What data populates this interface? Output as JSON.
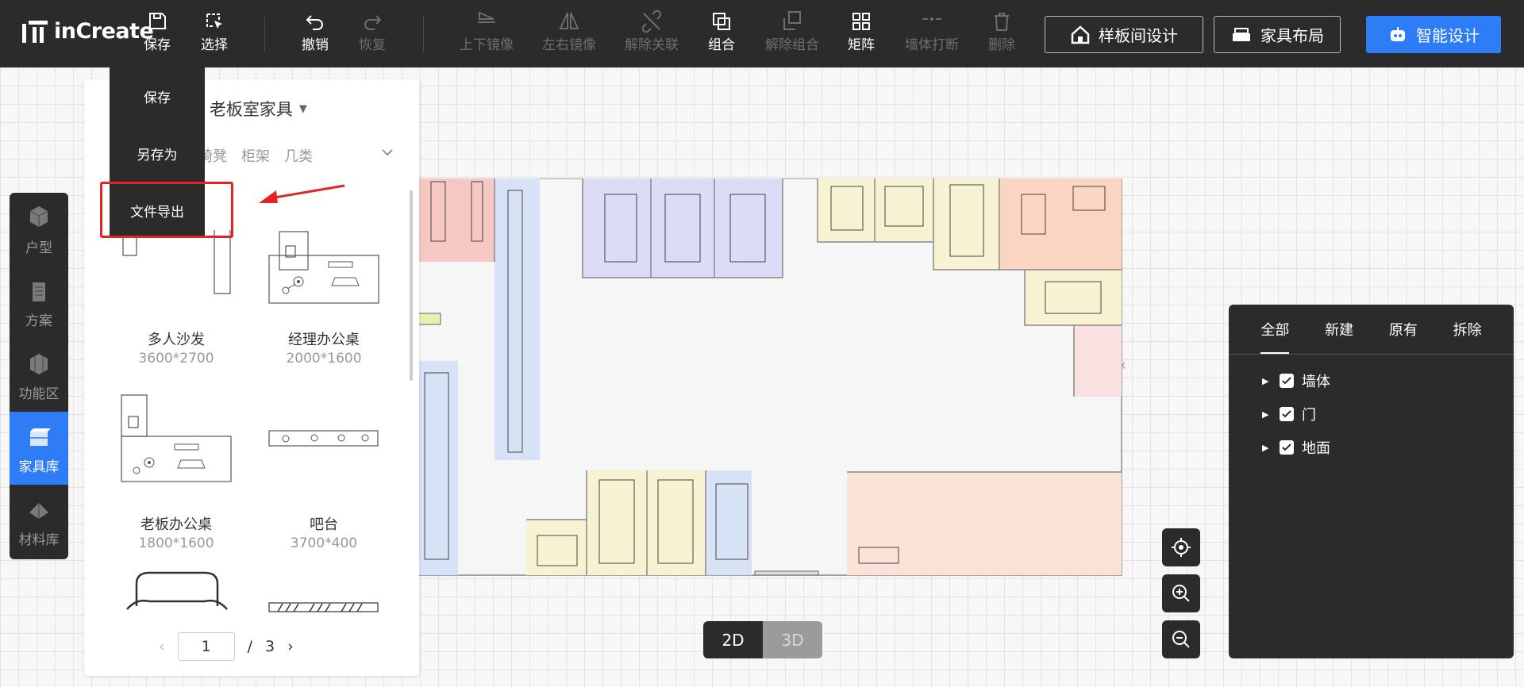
{
  "app": {
    "name": "inCreate"
  },
  "toolbar": {
    "save": "保存",
    "select": "选择",
    "undo": "撤销",
    "redo": "恢复",
    "mirror_v": "上下镜像",
    "mirror_h": "左右镜像",
    "unlink": "解除关联",
    "group": "组合",
    "ungroup": "解除组合",
    "array": "矩阵",
    "wall_break": "墙体打断",
    "delete": "删除"
  },
  "actions": {
    "room_design": "样板间设计",
    "furniture_layout": "家具布局",
    "smart_design": "智能设计"
  },
  "save_menu": {
    "items": [
      "保存",
      "另存为",
      "文件导出"
    ],
    "highlighted": "文件导出"
  },
  "left_nav": {
    "items": [
      "户型",
      "方案",
      "功能区",
      "家具库",
      "材料库"
    ],
    "active": "家具库"
  },
  "library": {
    "category": "老板室家具",
    "filters": [
      "椅凳",
      "柜架",
      "几类"
    ],
    "items": [
      {
        "name": "多人沙发",
        "size": "3600*2700"
      },
      {
        "name": "经理办公桌",
        "size": "2000*1600"
      },
      {
        "name": "老板办公桌",
        "size": "1800*1600"
      },
      {
        "name": "吧台",
        "size": "3700*400"
      }
    ],
    "pager": {
      "current": "1",
      "separator": "/",
      "total": "3"
    }
  },
  "layers": {
    "tabs": [
      "全部",
      "新建",
      "原有",
      "拆除"
    ],
    "active_tab": "全部",
    "rows": [
      "墙体",
      "门",
      "地面"
    ]
  },
  "view_toggle": {
    "d2": "2D",
    "d3": "3D",
    "active": "2D"
  },
  "colors": {
    "accent": "#2e7cf6",
    "dark": "#2b2b2c",
    "highlight": "#e32424"
  }
}
